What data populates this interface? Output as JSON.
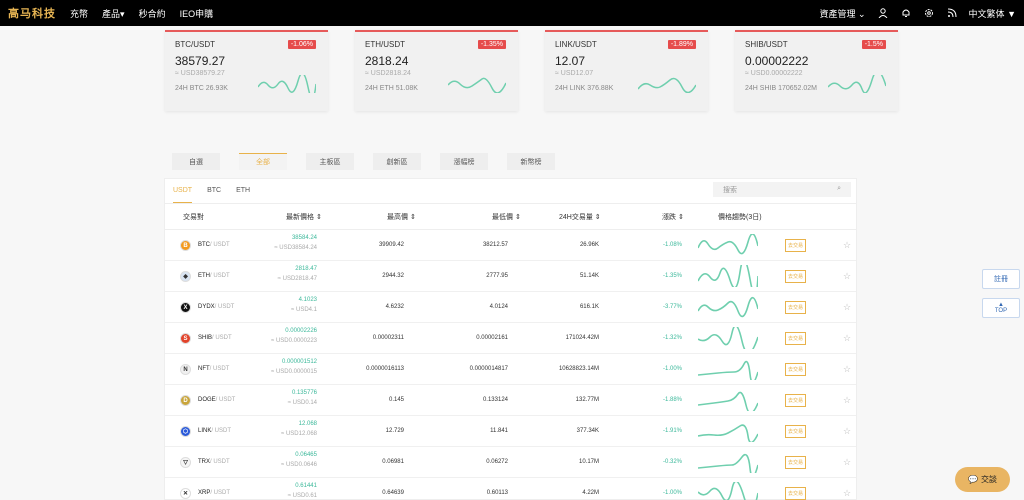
{
  "nav": {
    "logo": "高马科技",
    "items": [
      "充幣",
      "產品",
      "秒合約",
      "IEO申購"
    ],
    "asset_mgmt": "資產管理",
    "language": "中文繁体"
  },
  "cards": [
    {
      "pair": "BTC/USDT",
      "change": "-1.06%",
      "price": "38579.27",
      "usd": "≈ USD38579.27",
      "vol": "24H BTC 26.93K"
    },
    {
      "pair": "ETH/USDT",
      "change": "-1.35%",
      "price": "2818.24",
      "usd": "≈ USD2818.24",
      "vol": "24H ETH 51.08K"
    },
    {
      "pair": "LINK/USDT",
      "change": "-1.89%",
      "price": "12.07",
      "usd": "≈ USD12.07",
      "vol": "24H LINK 376.88K"
    },
    {
      "pair": "SHIB/USDT",
      "change": "-1.5%",
      "price": "0.00002222",
      "usd": "≈ USD0.00002222",
      "vol": "24H SHIB 170652.02M"
    }
  ],
  "tabs": [
    "自選",
    "全部",
    "主板區",
    "創新區",
    "漲幅榜",
    "新幣榜"
  ],
  "subtabs": [
    "USDT",
    "BTC",
    "ETH"
  ],
  "search_placeholder": "搜索",
  "headers": {
    "pair": "交易對",
    "last": "最新價格 ⇕",
    "high": "最高價 ⇕",
    "low": "最低價 ⇕",
    "vol": "24H交易量 ⇕",
    "chg": "漲跌 ⇕",
    "trend": "價格趨勢(3日)"
  },
  "rows": [
    {
      "sym": "BTC",
      "quote": "/ USDT",
      "last": "38584.24",
      "usd": "≈ USD38584.24",
      "high": "39909.42",
      "low": "38212.57",
      "vol": "26.96K",
      "chg": "-1.08%",
      "icon": "btc-icon",
      "color": "#f39a1e",
      "glyph": "B"
    },
    {
      "sym": "ETH",
      "quote": "/ USDT",
      "last": "2818.47",
      "usd": "≈ USD2818.47",
      "high": "2944.32",
      "low": "2777.95",
      "vol": "51.14K",
      "chg": "-1.35%",
      "icon": "eth-icon",
      "color": "#d9e4f2",
      "glyph": "◆"
    },
    {
      "sym": "DYDX",
      "quote": "/ USDT",
      "last": "4.1023",
      "usd": "≈ USD4.1",
      "high": "4.6232",
      "low": "4.0124",
      "vol": "616.1K",
      "chg": "-3.77%",
      "icon": "dydx-icon",
      "color": "#111111",
      "glyph": "X"
    },
    {
      "sym": "SHIB",
      "quote": "/ USDT",
      "last": "0.00002226",
      "usd": "≈ USD0.0000223",
      "high": "0.00002311",
      "low": "0.00002161",
      "vol": "171024.42M",
      "chg": "-1.32%",
      "icon": "shib-icon",
      "color": "#e2432a",
      "glyph": "S"
    },
    {
      "sym": "NFT",
      "quote": "/ USDT",
      "last": "0.000001512",
      "usd": "≈ USD0.0000015",
      "high": "0.0000016113",
      "low": "0.0000014817",
      "vol": "10628823.14M",
      "chg": "-1.00%",
      "icon": "nft-icon",
      "color": "#f0f0f0",
      "glyph": "N"
    },
    {
      "sym": "DOGE",
      "quote": "/ USDT",
      "last": "0.135776",
      "usd": "≈ USD0.14",
      "high": "0.145",
      "low": "0.133124",
      "vol": "132.77M",
      "chg": "-1.88%",
      "icon": "doge-icon",
      "color": "#c9a53b",
      "glyph": "D"
    },
    {
      "sym": "LINK",
      "quote": "/ USDT",
      "last": "12.068",
      "usd": "≈ USD12.068",
      "high": "12.729",
      "low": "11.841",
      "vol": "377.34K",
      "chg": "-1.91%",
      "icon": "link-icon",
      "color": "#2a5ada",
      "glyph": "⬡"
    },
    {
      "sym": "TRX",
      "quote": "/ USDT",
      "last": "0.06465",
      "usd": "≈ USD0.0646",
      "high": "0.06981",
      "low": "0.06272",
      "vol": "10.17M",
      "chg": "-0.32%",
      "icon": "trx-icon",
      "color": "#f5f5f5",
      "glyph": "▽"
    },
    {
      "sym": "XRP",
      "quote": "/ USDT",
      "last": "0.61441",
      "usd": "≈ USD0.61",
      "high": "0.64639",
      "low": "0.60113",
      "vol": "4.22M",
      "chg": "-1.00%",
      "icon": "xrp-icon",
      "color": "#ffffff",
      "glyph": "✕"
    }
  ],
  "watch_label": "去交易",
  "side": {
    "service": "註冊",
    "top": "TOP"
  },
  "chat": "交談",
  "colors": {
    "accent": "#e8b24a",
    "up": "#3bb89a",
    "down": "#e64c4c"
  }
}
